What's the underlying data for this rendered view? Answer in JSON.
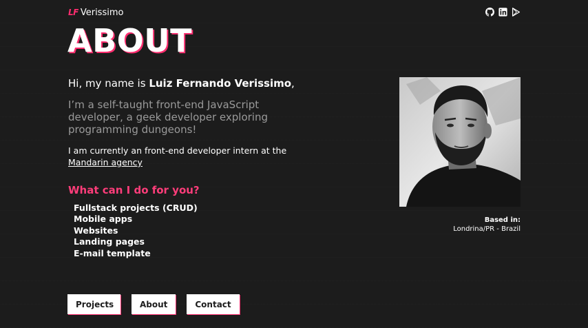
{
  "header": {
    "logo_mark": "LF",
    "logo_text": "Verissimo",
    "social_icons": [
      "github-icon",
      "linkedin-icon",
      "play-store-icon"
    ]
  },
  "title": "ABOUT",
  "intro": {
    "greeting": "Hi, my name is ",
    "name": "Luiz Fernando Verissimo",
    "suffix": ","
  },
  "tagline": "I’m a self-taught front-end JavaScript developer, a geek developer exploring programming dungeons!",
  "current": {
    "text": "I am currently an front-end developer intern at the ",
    "link_text": "Mandarin agency"
  },
  "services": {
    "title": "What can I do for you?",
    "items": [
      "Fullstack projects (CRUD)",
      "Mobile apps",
      "Websites",
      "Landing pages",
      "E-mail template"
    ]
  },
  "location": {
    "label": "Based in:",
    "value": "Londrina/PR - Brazil"
  },
  "nav": {
    "projects": "Projects",
    "about": "About",
    "contact": "Contact"
  },
  "colors": {
    "background": "#1c1c1c",
    "accent": "#ff2d6f",
    "muted_text": "#9a9a9a"
  }
}
